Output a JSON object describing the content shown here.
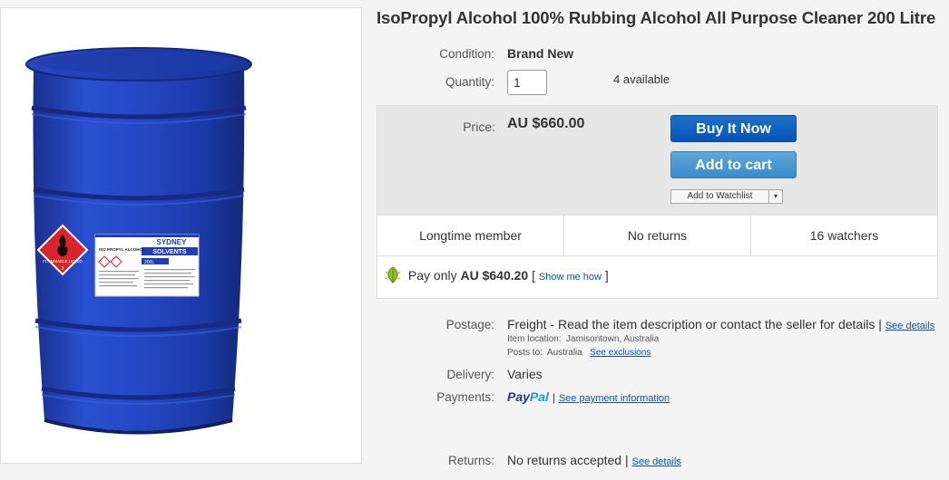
{
  "listing": {
    "title": "IsoPropyl Alcohol 100% Rubbing Alcohol All Purpose Cleaner 200 Litre"
  },
  "image": {
    "label_brand_line1": "SYDNEY",
    "label_brand_line2": "SOLVENTS",
    "label_product": "ISO PROPYL ALCOHOL",
    "label_volume": "200L",
    "hazard_text": "FLAMMABLE LIQUID",
    "hazard_class": "3",
    "drum_color": "#1f3fb8"
  },
  "condition": {
    "label": "Condition:",
    "value": "Brand New"
  },
  "quantity": {
    "label": "Quantity:",
    "value": "1",
    "available": "4 available"
  },
  "price": {
    "label": "Price:",
    "value": "AU $660.00"
  },
  "buttons": {
    "buy_now": "Buy It Now",
    "add_to_cart": "Add to cart",
    "watchlist": "Add to Watchlist",
    "watchlist_arrow": "▾"
  },
  "features": [
    "Longtime member",
    "No returns",
    "16 watchers"
  ],
  "pay_only": {
    "prefix": "Pay only",
    "amount": "AU $640.20",
    "bracket_open": "[",
    "link": "Show me how",
    "bracket_close": "]"
  },
  "postage": {
    "label": "Postage:",
    "value": "Freight - Read the item description or contact the seller for details |",
    "details_link": "See details",
    "item_location_label": "Item location:",
    "item_location": "Jamisontown, Australia",
    "posts_to_label": "Posts to:",
    "posts_to": "Australia",
    "exclusions_link": "See exclusions"
  },
  "delivery": {
    "label": "Delivery:",
    "value": "Varies"
  },
  "payments": {
    "label": "Payments:",
    "paypal_part1": "Pay",
    "paypal_part2": "Pal",
    "separator": "|",
    "link": "See payment information"
  },
  "returns": {
    "label": "Returns:",
    "value": "No returns accepted |",
    "link": "See details"
  },
  "colors": {
    "accent_blue": "#0654ba",
    "buy_button": "#0654ba",
    "cart_button": "#3a8cc9",
    "paypal_dark": "#253b80",
    "paypal_light": "#179bd7"
  }
}
